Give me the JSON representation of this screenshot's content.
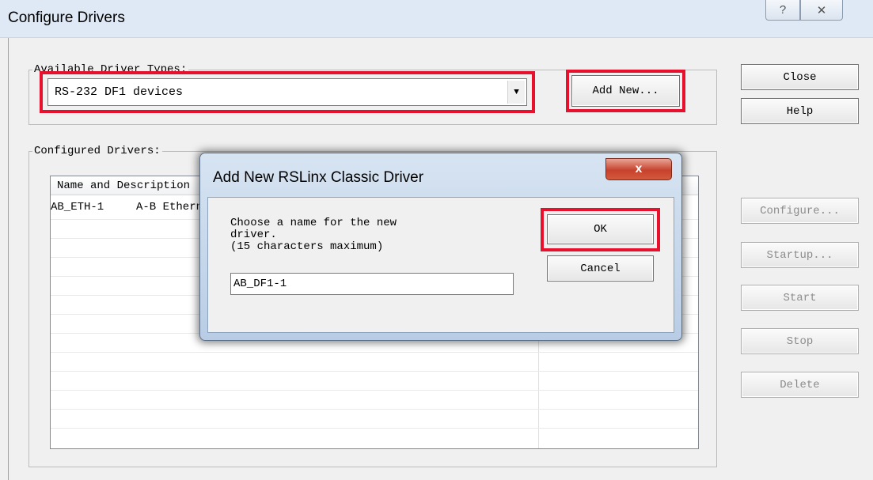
{
  "window": {
    "title": "Configure Drivers",
    "help_glyph": "?",
    "close_glyph": "✕"
  },
  "available": {
    "legend": "Available Driver Types:",
    "selected": "RS-232 DF1 devices",
    "add_new_label": "Add New..."
  },
  "side_buttons": {
    "close": "Close",
    "help": "Help",
    "configure": "Configure...",
    "startup": "Startup...",
    "start": "Start",
    "stop": "Stop",
    "delete": "Delete"
  },
  "configured": {
    "legend": "Configured Drivers:",
    "column_header": "Name and Description",
    "rows": [
      {
        "name": "AB_ETH-1",
        "description": "A-B Ethernet RUNNING"
      }
    ]
  },
  "dialog": {
    "title": "Add New RSLinx Classic Driver",
    "close_glyph": "x",
    "prompt_line1": "Choose a name for the new",
    "prompt_line2": "driver.",
    "prompt_line3": "(15 characters maximum)",
    "input_value": "AB_DF1-1",
    "ok_label": "OK",
    "cancel_label": "Cancel"
  },
  "colors": {
    "highlight": "#e8112d",
    "titlebar": "#dfe9f5",
    "dialog_frame": "#b8cde5"
  }
}
